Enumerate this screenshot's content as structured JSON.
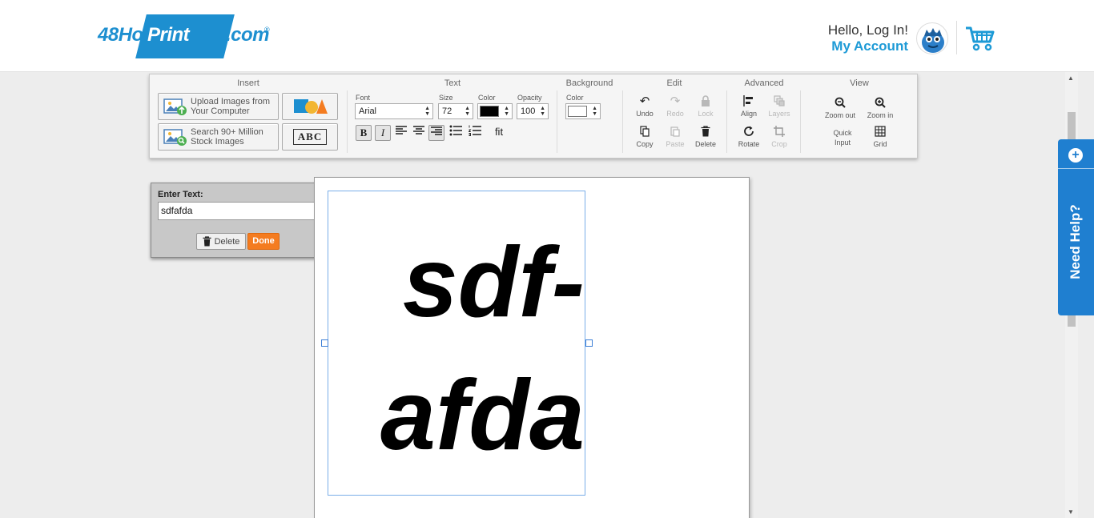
{
  "header": {
    "logo": {
      "part1": "48Hour",
      "part2": "Print",
      "part3": ".com",
      "registered": "®"
    },
    "greeting": "Hello, Log In!",
    "account_link": "My Account"
  },
  "toolbar": {
    "sections": {
      "insert": "Insert",
      "text": "Text",
      "background": "Background",
      "edit": "Edit",
      "advanced": "Advanced",
      "view": "View"
    },
    "insert": {
      "upload_line1": "Upload Images from",
      "upload_line2": "Your Computer",
      "search_line1": "Search 90+ Million",
      "search_line2": "Stock Images",
      "text_tool_label": "ABC"
    },
    "text": {
      "font_label": "Font",
      "font_value": "Arial",
      "size_label": "Size",
      "size_value": "72",
      "color_label": "Color",
      "color_value": "#000000",
      "opacity_label": "Opacity",
      "opacity_value": "100",
      "bold": "B",
      "italic": "I",
      "fit": "fit"
    },
    "background": {
      "color_label": "Color",
      "color_value": "#ffffff"
    },
    "edit": {
      "undo": "Undo",
      "redo": "Redo",
      "lock": "Lock",
      "copy": "Copy",
      "paste": "Paste",
      "delete": "Delete"
    },
    "advanced": {
      "align": "Align",
      "layers": "Layers",
      "rotate": "Rotate",
      "crop": "Crop"
    },
    "view": {
      "zoom_out": "Zoom out",
      "zoom_in": "Zoom in",
      "quick_input_1": "Quick",
      "quick_input_2": "Input",
      "grid": "Grid"
    }
  },
  "text_panel": {
    "label": "Enter Text:",
    "value": "sdfafda",
    "delete_label": "Delete",
    "done_label": "Done"
  },
  "canvas": {
    "line1": "sdf-",
    "line2": "afda"
  },
  "help": {
    "label": "Need Help?",
    "plus": "+"
  },
  "colors": {
    "brand_blue": "#1d8fd0",
    "done_orange": "#f47c20",
    "help_blue": "#1f7fd0"
  }
}
